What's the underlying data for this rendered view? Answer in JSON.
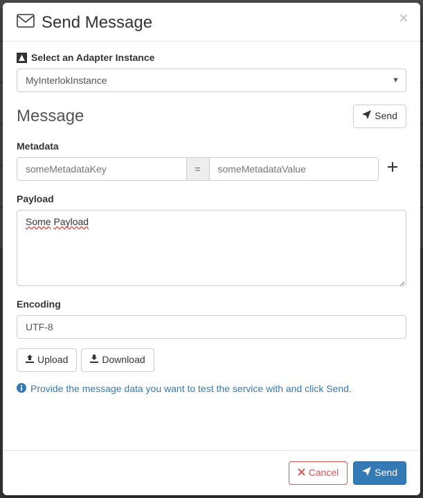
{
  "header": {
    "title": "Send Message"
  },
  "adapter": {
    "label": "Select an Adapter Instance",
    "selected": "MyInterlokInstance"
  },
  "message": {
    "heading": "Message",
    "send_label": "Send"
  },
  "metadata": {
    "label": "Metadata",
    "key_placeholder": "someMetadataKey",
    "eq": "=",
    "value_placeholder": "someMetadataValue"
  },
  "payload": {
    "label": "Payload",
    "word1": "Some",
    "word2": "Payload"
  },
  "encoding": {
    "label": "Encoding",
    "value": "UTF-8"
  },
  "buttons": {
    "upload": "Upload",
    "download": "Download",
    "cancel": "Cancel",
    "send": "Send"
  },
  "info": {
    "text": "Provide the message data you want to test the service with and click Send."
  }
}
